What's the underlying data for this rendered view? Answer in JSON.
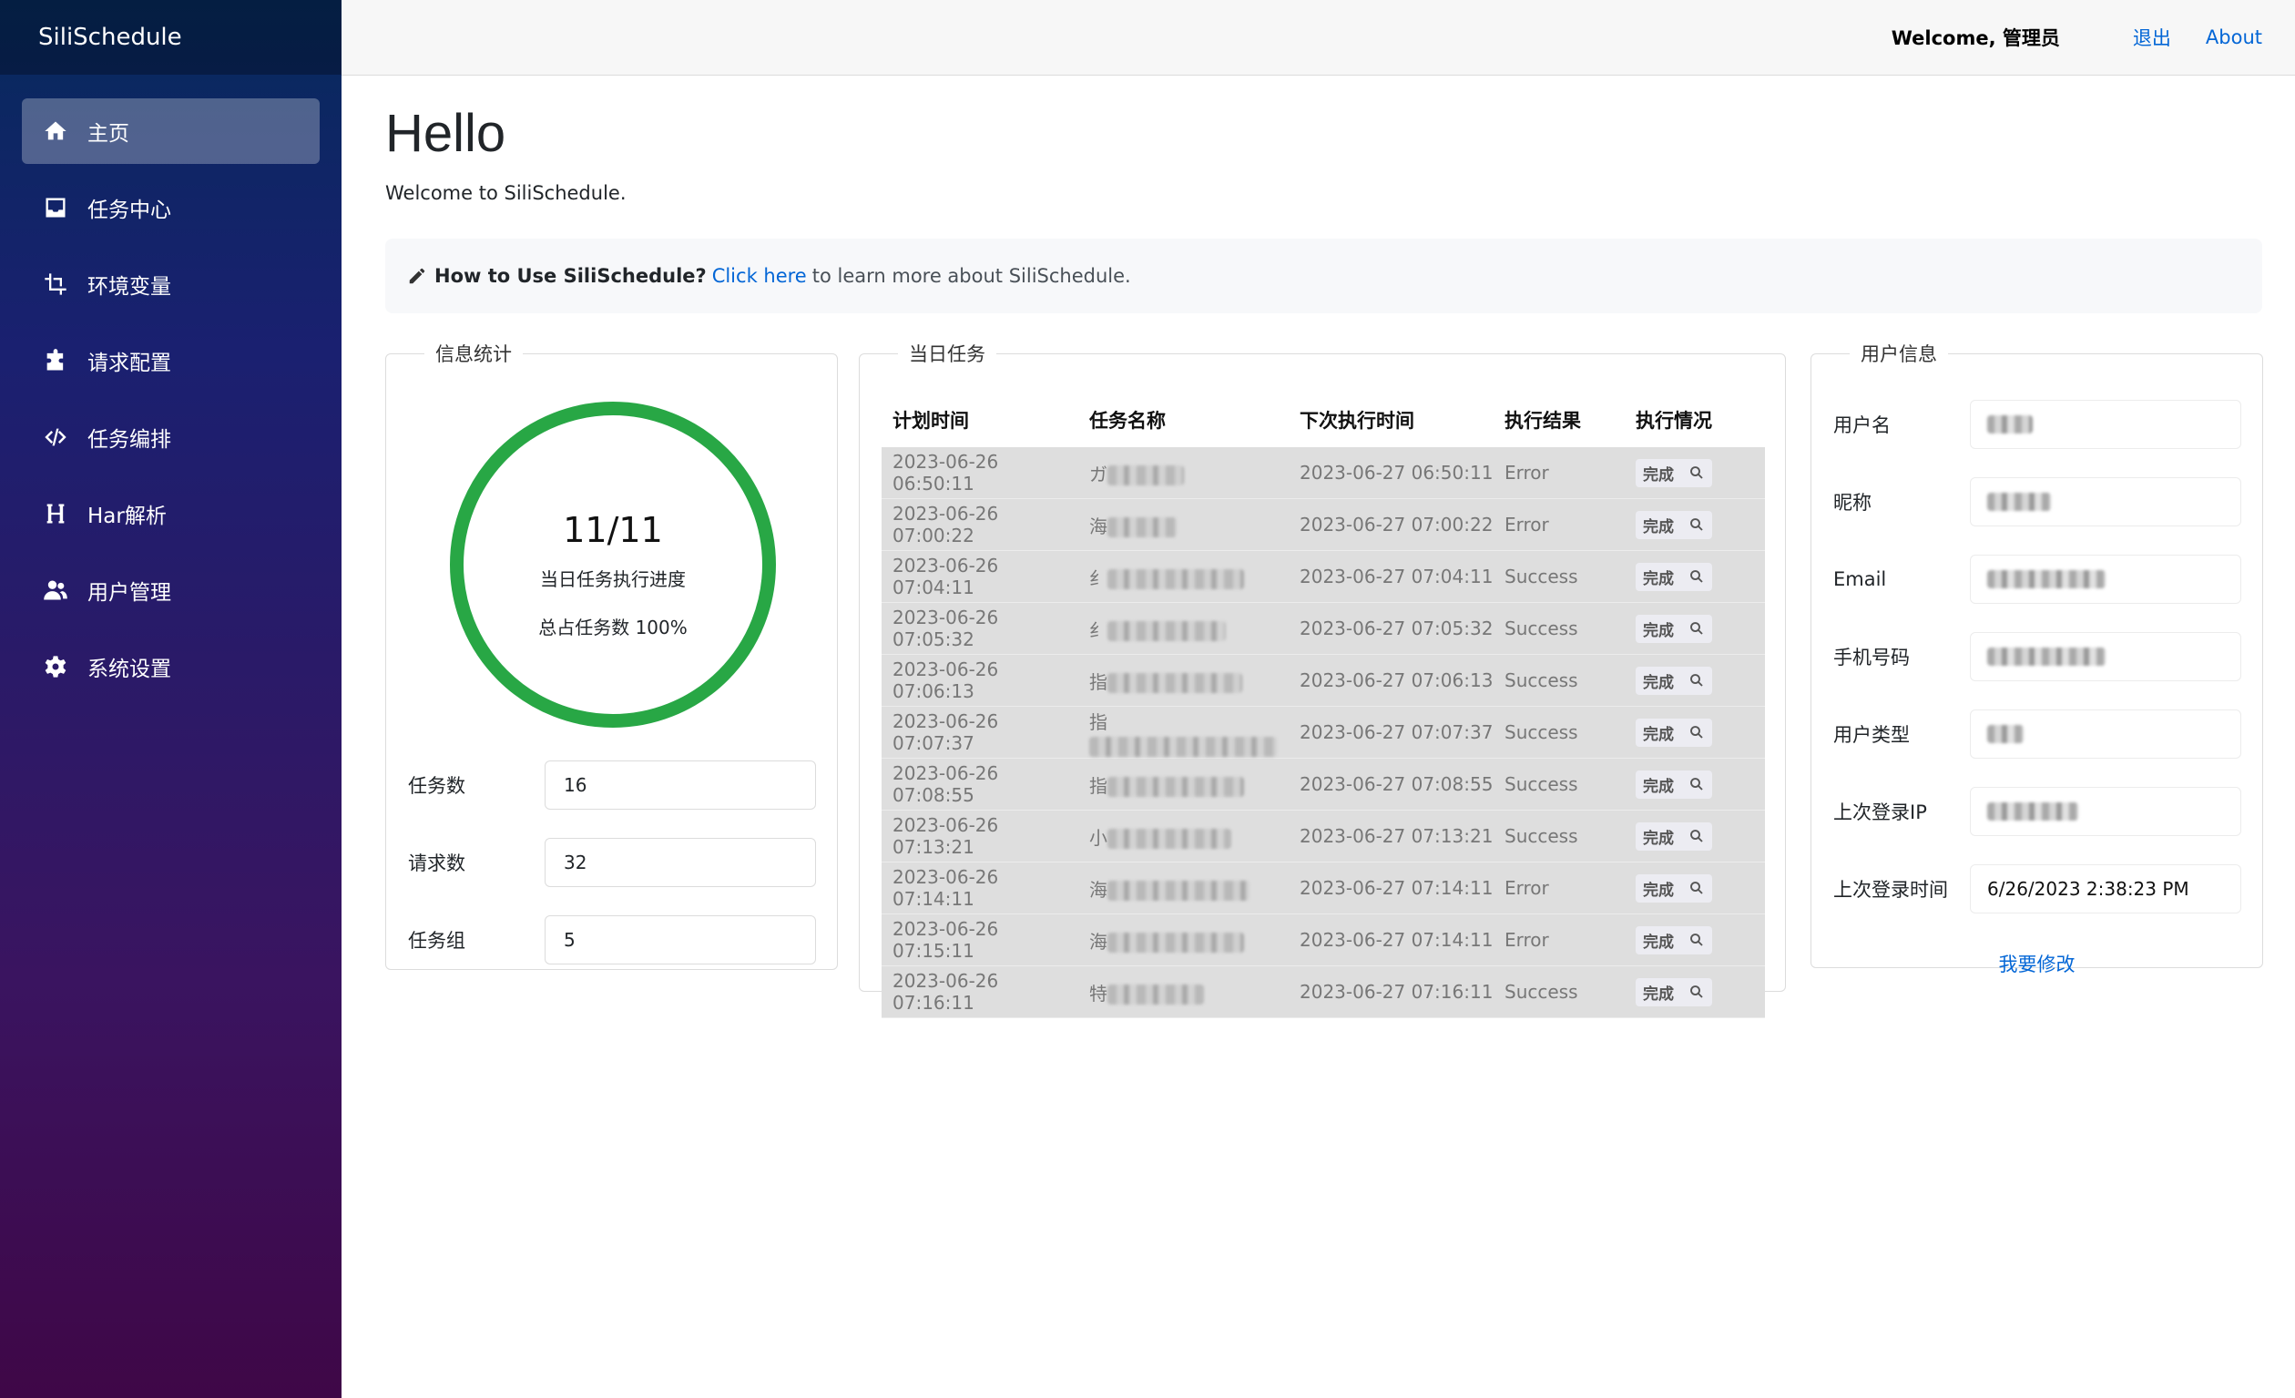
{
  "brand": "SiliSchedule",
  "nav": [
    {
      "label": "主页",
      "icon": "home-icon",
      "active": true
    },
    {
      "label": "任务中心",
      "icon": "inbox-icon"
    },
    {
      "label": "环境变量",
      "icon": "crop-icon"
    },
    {
      "label": "请求配置",
      "icon": "puzzle-icon"
    },
    {
      "label": "任务编排",
      "icon": "code-icon"
    },
    {
      "label": "Har解析",
      "icon": "heading-icon"
    },
    {
      "label": "用户管理",
      "icon": "users-icon"
    },
    {
      "label": "系统设置",
      "icon": "gear-icon"
    }
  ],
  "topbar": {
    "welcome": "Welcome, 管理员",
    "logout": "退出",
    "about": "About"
  },
  "main": {
    "title": "Hello",
    "subtitle": "Welcome to SiliSchedule.",
    "howto": {
      "bold": "How to Use SiliSchedule?",
      "link": "Click here",
      "rest": "to learn more about SiliSchedule."
    }
  },
  "stats": {
    "legend": "信息统计",
    "progress_text": "11/11",
    "progress_fraction": 1.0,
    "progress_label": "当日任务执行进度",
    "percent_label": "总占任务数 100%",
    "ring_color": "#28a745",
    "rows": [
      {
        "label": "任务数",
        "value": "16"
      },
      {
        "label": "请求数",
        "value": "32"
      },
      {
        "label": "任务组",
        "value": "5"
      }
    ]
  },
  "tasks": {
    "legend": "当日任务",
    "headers": [
      "计划时间",
      "任务名称",
      "下次执行时间",
      "执行结果",
      "执行情况"
    ],
    "done_label": "完成",
    "rows": [
      {
        "planned": "2023-06-26 06:50:11",
        "name_prefix": "ガ",
        "next": "2023-06-27 06:50:11",
        "result": "Error"
      },
      {
        "planned": "2023-06-26 07:00:22",
        "name_prefix": "海",
        "next": "2023-06-27 07:00:22",
        "result": "Error"
      },
      {
        "planned": "2023-06-26 07:04:11",
        "name_prefix": "纟",
        "next": "2023-06-27 07:04:11",
        "result": "Success"
      },
      {
        "planned": "2023-06-26 07:05:32",
        "name_prefix": "纟",
        "next": "2023-06-27 07:05:32",
        "result": "Success"
      },
      {
        "planned": "2023-06-26 07:06:13",
        "name_prefix": "指",
        "next": "2023-06-27 07:06:13",
        "result": "Success"
      },
      {
        "planned": "2023-06-26 07:07:37",
        "name_prefix": "指",
        "next": "2023-06-27 07:07:37",
        "result": "Success"
      },
      {
        "planned": "2023-06-26 07:08:55",
        "name_prefix": "指",
        "next": "2023-06-27 07:08:55",
        "result": "Success"
      },
      {
        "planned": "2023-06-26 07:13:21",
        "name_prefix": "小",
        "next": "2023-06-27 07:13:21",
        "result": "Success"
      },
      {
        "planned": "2023-06-26 07:14:11",
        "name_prefix": "海",
        "next": "2023-06-27 07:14:11",
        "result": "Error"
      },
      {
        "planned": "2023-06-26 07:15:11",
        "name_prefix": "海",
        "next": "2023-06-27 07:14:11",
        "result": "Error"
      },
      {
        "planned": "2023-06-26 07:16:11",
        "name_prefix": "特",
        "next": "2023-06-27 07:16:11",
        "result": "Success"
      }
    ]
  },
  "user": {
    "legend": "用户信息",
    "rows": [
      {
        "label": "用户名",
        "value": ""
      },
      {
        "label": "昵称",
        "value": ""
      },
      {
        "label": "Email",
        "value": ""
      },
      {
        "label": "手机号码",
        "value": ""
      },
      {
        "label": "用户类型",
        "value": ""
      },
      {
        "label": "上次登录IP",
        "value": ""
      },
      {
        "label": "上次登录时间",
        "value": "6/26/2023 2:38:23 PM"
      }
    ],
    "modify": "我要修改"
  }
}
